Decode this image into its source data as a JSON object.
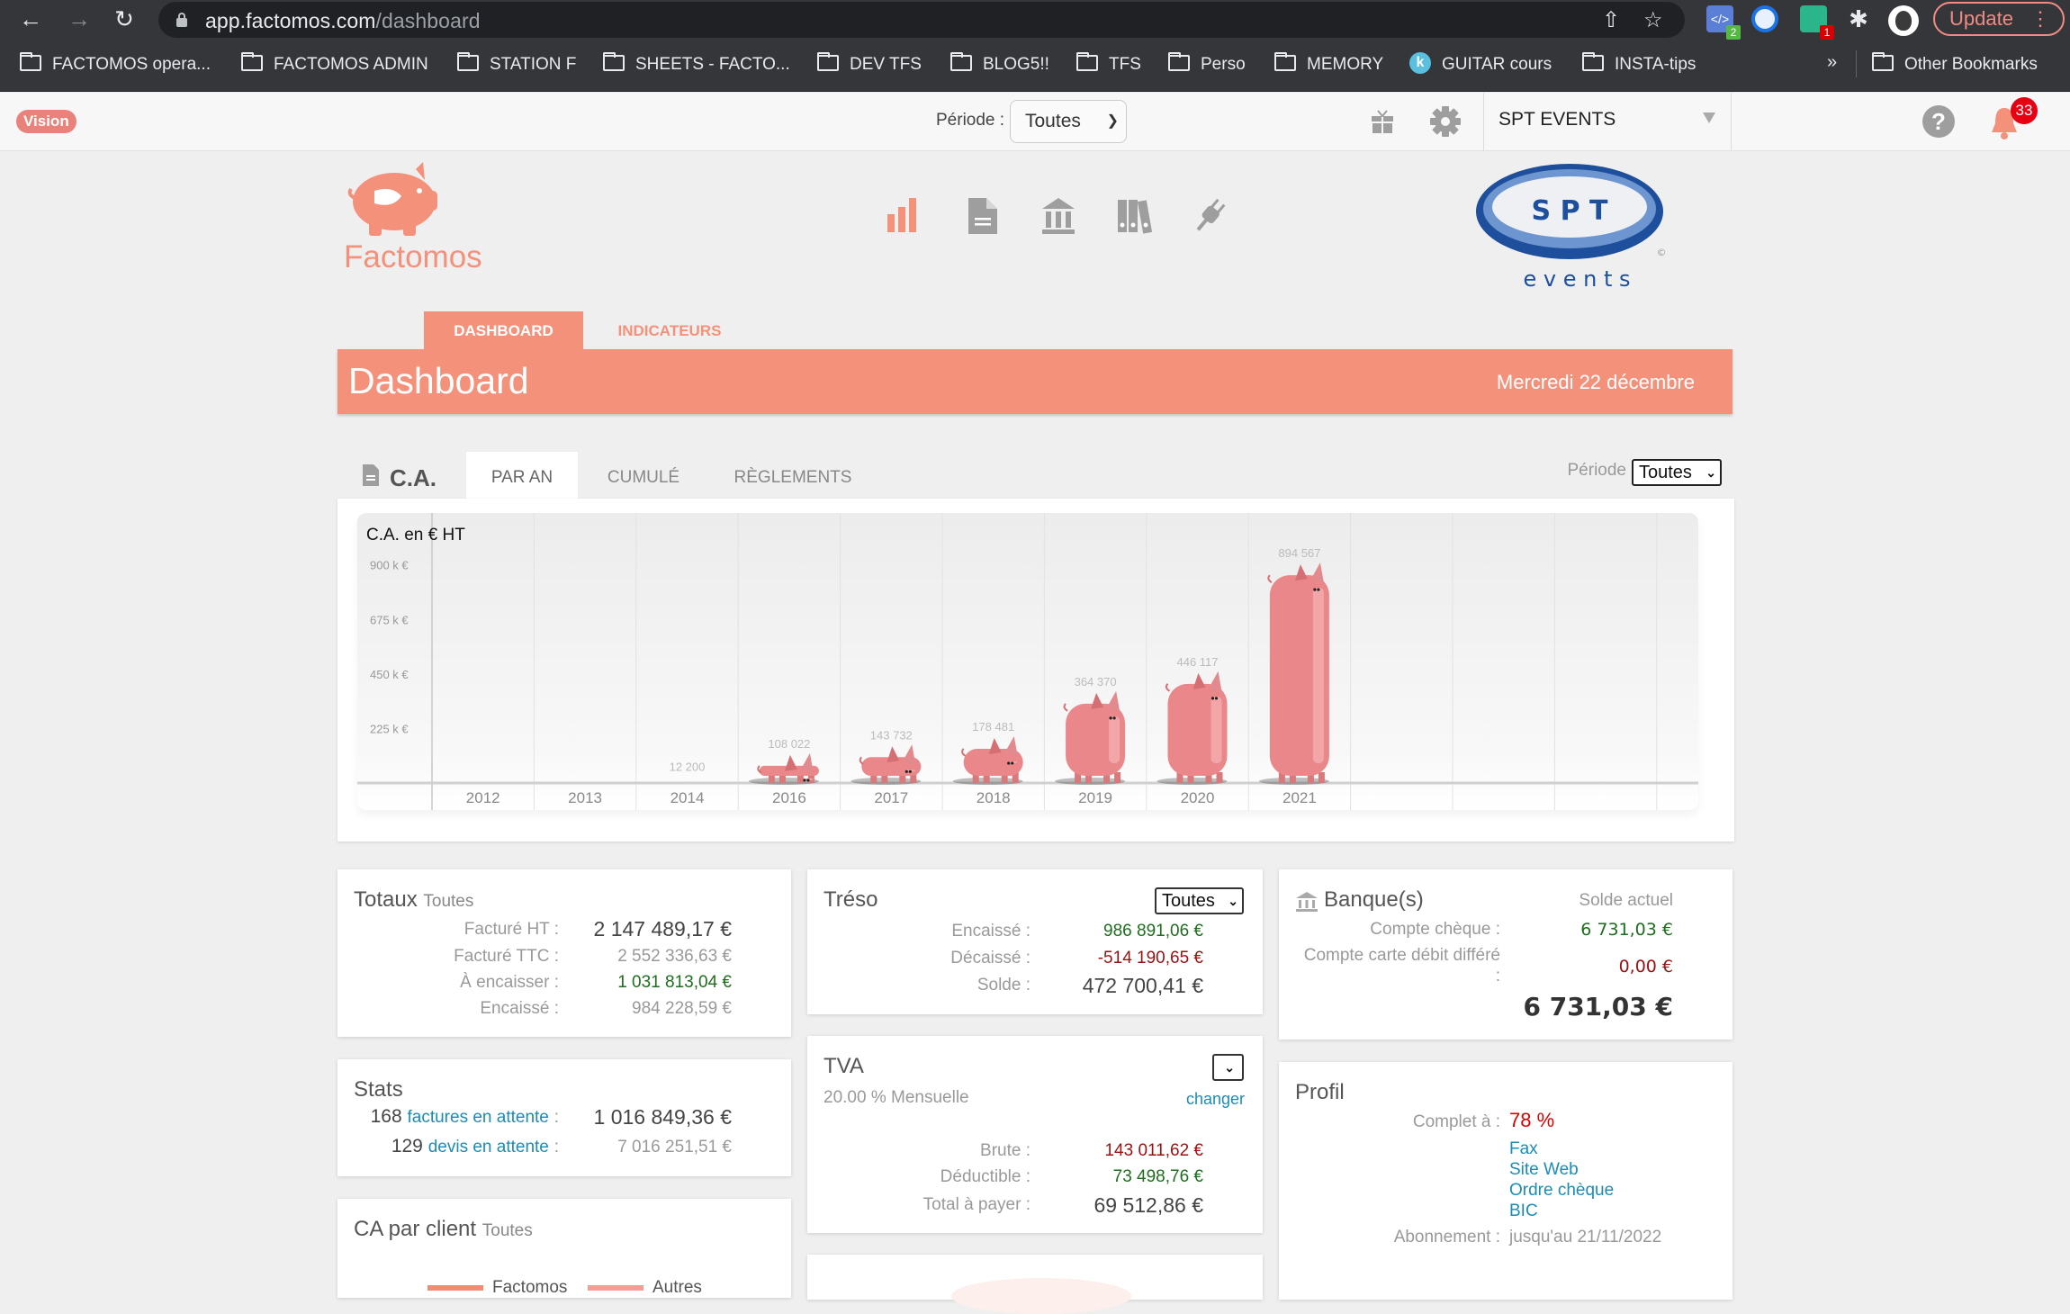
{
  "browser": {
    "url_host": "app.factomos.com",
    "url_path": "/dashboard",
    "update_label": "Update",
    "extension_badges": [
      "2",
      "1"
    ],
    "bookmarks": [
      {
        "label": "FACTOMOS opera...",
        "icon": "folder-icon"
      },
      {
        "label": "FACTOMOS ADMIN",
        "icon": "folder-icon"
      },
      {
        "label": "STATION F",
        "icon": "folder-icon"
      },
      {
        "label": "SHEETS - FACTO...",
        "icon": "folder-icon"
      },
      {
        "label": "DEV TFS",
        "icon": "folder-icon"
      },
      {
        "label": "BLOG5!!",
        "icon": "folder-icon"
      },
      {
        "label": "TFS",
        "icon": "folder-icon"
      },
      {
        "label": "Perso",
        "icon": "folder-icon"
      },
      {
        "label": "MEMORY",
        "icon": "folder-icon"
      },
      {
        "label": "GUITAR cours",
        "icon": "k-site-icon"
      },
      {
        "label": "INSTA-tips",
        "icon": "folder-icon"
      }
    ],
    "more_bookmarks": "»",
    "other_bookmarks": "Other Bookmarks"
  },
  "appbar": {
    "vision_badge": "Vision",
    "periode_label": "Période :",
    "periode_value": "Toutes",
    "company": "SPT EVENTS",
    "notifications_count": "33"
  },
  "brand": {
    "name": "Factomos",
    "accent": "#f4917b",
    "client_logo_text": "S P T",
    "client_logo_sub": "e v e n t s"
  },
  "page_tabs": [
    {
      "label": "DASHBOARD",
      "active": true
    },
    {
      "label": "INDICATEURS",
      "active": false
    }
  ],
  "banner": {
    "title": "Dashboard",
    "date": "Mercredi 22 décembre"
  },
  "ca": {
    "title": "C.A.",
    "tabs": [
      {
        "label": "PAR AN",
        "active": true
      },
      {
        "label": "CUMULÉ",
        "active": false
      },
      {
        "label": "RÈGLEMENTS",
        "active": false
      }
    ],
    "periode_label": "Période",
    "periode_value": "Toutes"
  },
  "chart_data": {
    "type": "bar",
    "title": "C.A. en € HT",
    "xlabel": "",
    "ylabel": "C.A. en € HT",
    "categories": [
      "2012",
      "2013",
      "2014",
      "2016",
      "2017",
      "2018",
      "2019",
      "2020",
      "2021"
    ],
    "values": [
      0,
      0,
      12200,
      108022,
      143732,
      178481,
      364370,
      446117,
      894567
    ],
    "value_labels": [
      "",
      "",
      "12 200",
      "108 022",
      "143 732",
      "178 481",
      "364 370",
      "446 117",
      "894 567"
    ],
    "yticks": [
      225000,
      450000,
      675000,
      900000
    ],
    "ytick_labels": [
      "225 k €",
      "450 k €",
      "675 k €",
      "900 k €"
    ],
    "ylim": [
      0,
      900000
    ],
    "grid": true,
    "bar_style": "piggy-bank",
    "bar_color": "#e9878a"
  },
  "totaux": {
    "title": "Totaux",
    "subtitle": "Toutes",
    "rows": [
      {
        "label": "Facturé HT :",
        "value": "2 147 489,17 €",
        "style": "big"
      },
      {
        "label": "Facturé TTC :",
        "value": "2 552 336,63 €",
        "style": "muted"
      },
      {
        "label": "À encaisser :",
        "value": "1 031 813,04 €",
        "style": "green"
      },
      {
        "label": "Encaissé :",
        "value": "984 228,59 €",
        "style": "muted"
      }
    ]
  },
  "stats": {
    "title": "Stats",
    "rows": [
      {
        "count": "168",
        "link": "factures en attente",
        "sep": ":",
        "value": "1 016 849,36 €"
      },
      {
        "count": "129",
        "link": "devis en attente",
        "sep": ":",
        "value": "7 016 251,51 €"
      }
    ]
  },
  "ca_client": {
    "title": "CA par client",
    "subtitle": "Toutes",
    "legend": [
      "Factomos",
      "Autres"
    ]
  },
  "treso": {
    "title": "Tréso",
    "select_value": "Toutes",
    "rows": [
      {
        "label": "Encaissé :",
        "value": "986 891,06 €",
        "style": "green"
      },
      {
        "label": "Décaissé :",
        "value": "-514 190,65 €",
        "style": "red"
      },
      {
        "label": "Solde :",
        "value": "472 700,41 €",
        "style": "big"
      }
    ]
  },
  "tva": {
    "title": "TVA",
    "rate": "20.00 % Mensuelle",
    "change_link": "changer",
    "rows": [
      {
        "label": "Brute :",
        "value": "143 011,62 €",
        "style": "red"
      },
      {
        "label": "Déductible :",
        "value": "73 498,76 €",
        "style": "green"
      },
      {
        "label": "Total à payer :",
        "value": "69 512,86 €",
        "style": "big"
      }
    ]
  },
  "banques": {
    "title": "Banque(s)",
    "solde_header": "Solde actuel",
    "accounts": [
      {
        "label": "Compte chèque :",
        "value": "6 731,03 €",
        "style": "green"
      },
      {
        "label": "Compte carte débit différé",
        "label_suffix": ":",
        "value": "0,00 €",
        "style": "red"
      }
    ],
    "total": "6 731,03 €"
  },
  "profil": {
    "title": "Profil",
    "complete_label": "Complet à :",
    "complete_value": "78 %",
    "complete_fraction": 0.78,
    "missing_fields": [
      "Fax",
      "Site Web",
      "Ordre chèque",
      "BIC"
    ],
    "abonnement_label": "Abonnement :",
    "abonnement_value": "jusqu'au 21/11/2022"
  }
}
